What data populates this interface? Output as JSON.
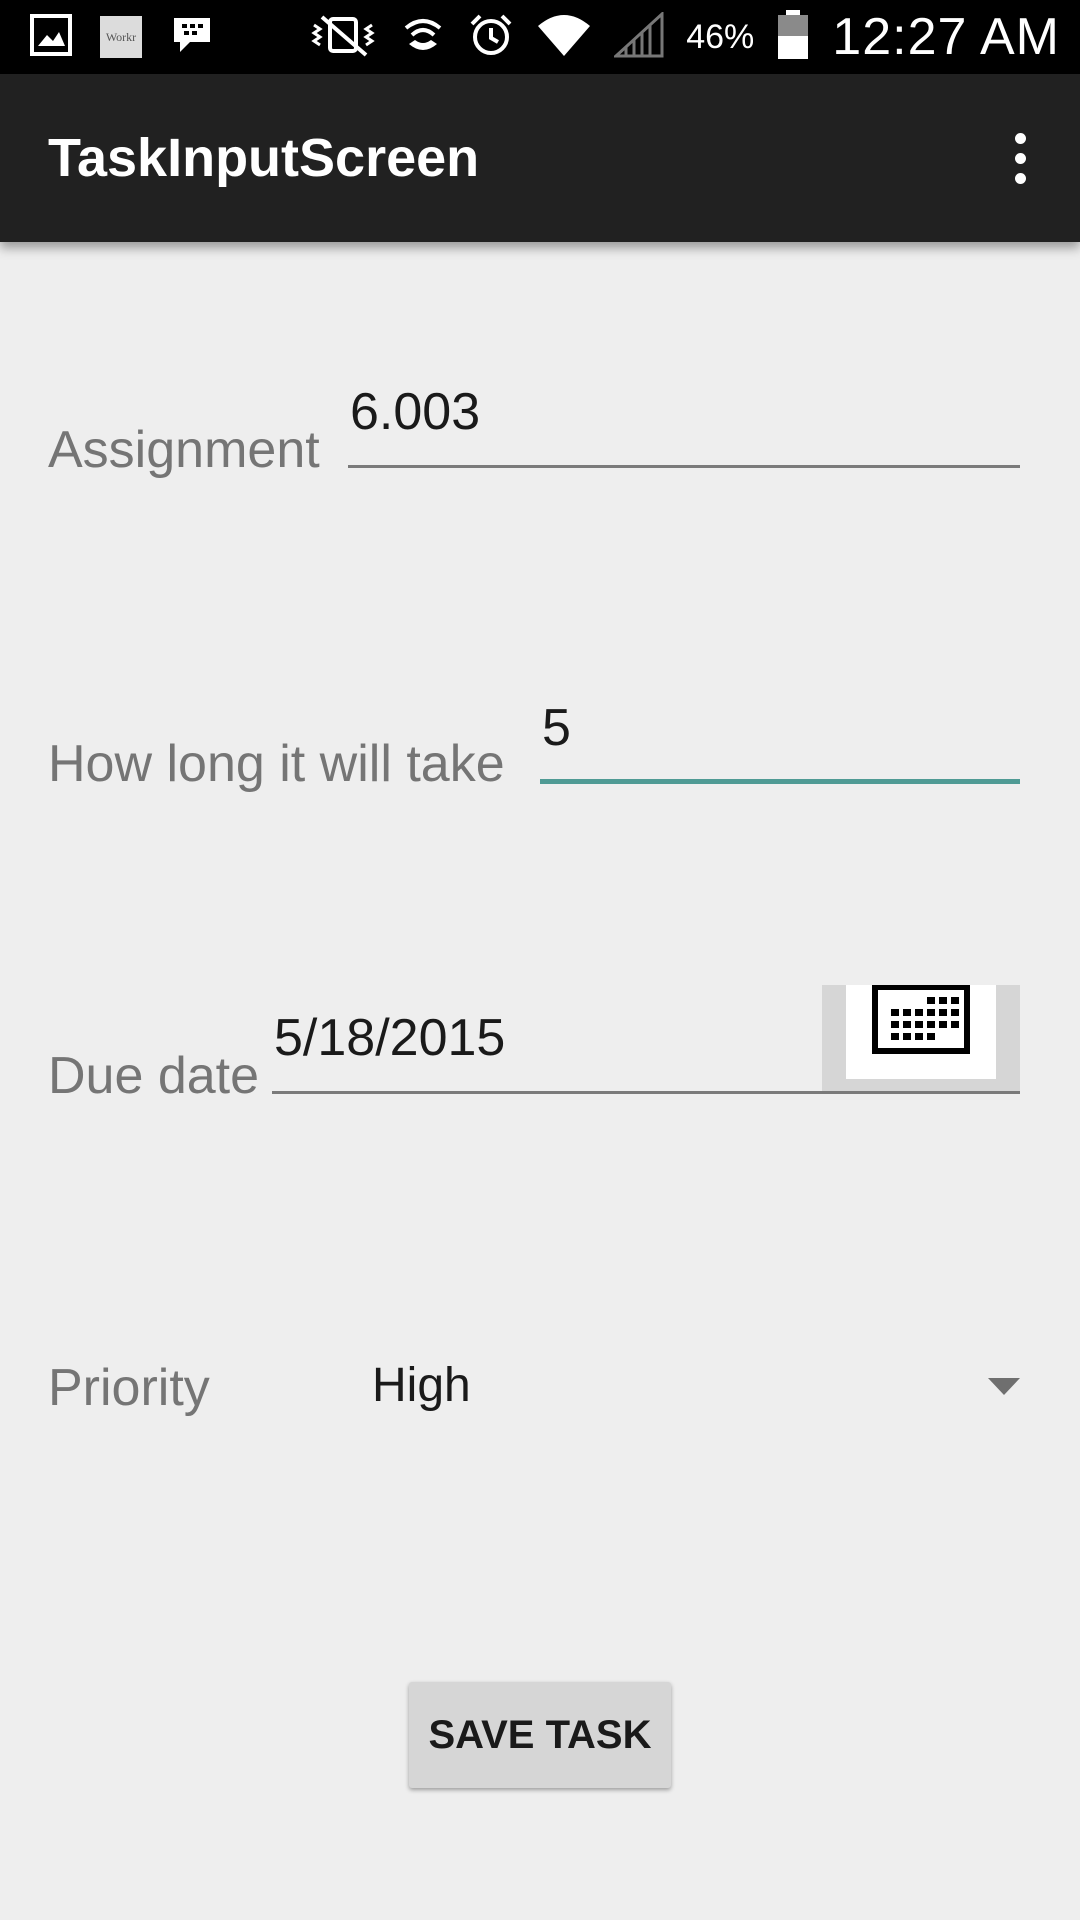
{
  "status_bar": {
    "icons_left": [
      "gallery-icon",
      "worker-app-icon",
      "bbm-icon"
    ],
    "worker_badge_text": "Workr",
    "icons_right": [
      "vibrate-mute-icon",
      "wifi-calling-icon",
      "alarm-icon",
      "wifi-icon",
      "signal-icon",
      "battery-icon"
    ],
    "battery_percent": "46%",
    "time": "12:27 AM"
  },
  "action_bar": {
    "title": "TaskInputScreen",
    "overflow_icon": "more-vert-icon"
  },
  "form": {
    "assignment": {
      "label": "Assignment",
      "value": "6.003"
    },
    "duration": {
      "label": "How long it will take",
      "value": "5",
      "focused": true
    },
    "due_date": {
      "label": "Due date",
      "value": "5/18/2015",
      "picker_icon": "calendar-icon"
    },
    "priority": {
      "label": "Priority",
      "selected": "High",
      "dropdown_icon": "dropdown-arrow-icon"
    },
    "save_button_label": "SAVE TASK"
  },
  "colors": {
    "status_bar_bg": "#000000",
    "action_bar_bg": "#212121",
    "page_bg": "#eeeeee",
    "accent_focus": "#4f9a94",
    "label_gray": "#757575"
  }
}
